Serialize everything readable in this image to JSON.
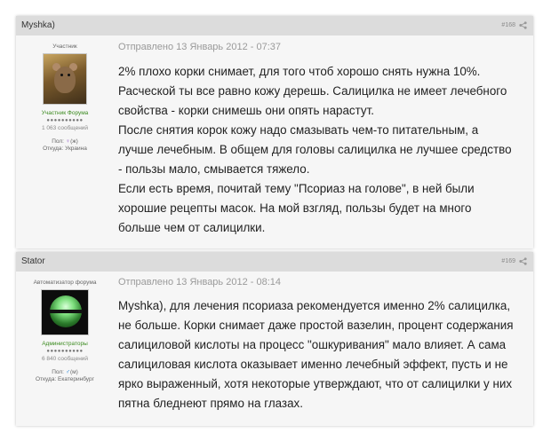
{
  "posts": [
    {
      "author": "Myshka)",
      "number": "#168",
      "rank_top": "Участник",
      "rank_title": "Участник Форума",
      "stars": "●●●●●●●●●●",
      "message_count": "1 063 сообщений",
      "gender_label": "Пол:",
      "gender_icon": "♀",
      "gender_text": "(ж)",
      "city": "Откуда: Украина",
      "date": "Отправлено 13 Январь 2012 - 07:37",
      "lines": [
        "2% плохо корки снимает, для того чтоб хорошо снять нужна 10%.",
        "Расческой ты все равно кожу дерешь. Салицилка не имеет лечебного",
        "свойства - корки снимешь они опять нарастут.",
        "После снятия корок кожу надо смазывать чем-то питательным, а",
        "лучше лечебным. В общем для головы салицилка не лучшее средство",
        "- пользы мало, смывается тяжело.",
        "Если есть время, почитай тему \"Псориаз на голове\", в ней были",
        "хорошие рецепты масок. На мой взгляд, пользы будет на много",
        "больше чем от салицилки."
      ]
    },
    {
      "author": "Stator",
      "number": "#169",
      "rank_top": "Автоматизатор форума",
      "rank_title": "Администраторы",
      "stars": "●●●●●●●●●●",
      "message_count": "6 840 сообщений",
      "gender_label": "Пол:",
      "gender_icon": "♂",
      "gender_text": "(м)",
      "city": "Откуда: Екатеринбург",
      "date": "Отправлено 13 Январь 2012 - 08:14",
      "lines": [
        "Myshka), для лечения псориаза рекомендуется именно 2% салицилка,",
        "не больше. Корки снимает даже простой вазелин, процент содержания",
        "салициловой кислоты на процесс \"ошкуривания\" мало влияет. А сама",
        "салициловая кислота оказывает именно лечебный эффект, пусть и не",
        "ярко выраженный, хотя некоторые утверждают, что от салицилки у них",
        "пятна бледнеют прямо на глазах."
      ]
    }
  ],
  "icons": {
    "share": "share-icon",
    "avatar1": "mouse-avatar",
    "avatar2": "green-orb-avatar"
  },
  "colors": {
    "header_bg": "#dcdcdc",
    "post_bg": "#f6f6f6",
    "rank_green": "#3a8a1e",
    "date_gray": "#9a9a9a"
  }
}
